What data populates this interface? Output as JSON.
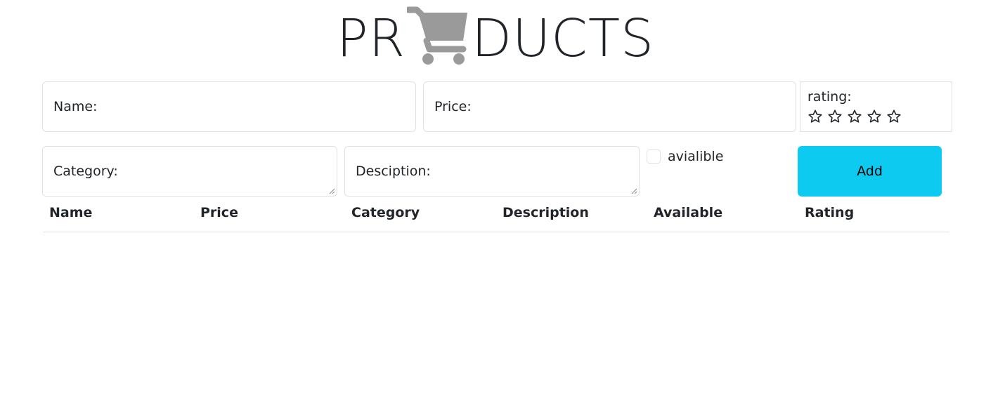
{
  "title": {
    "left": "PR",
    "right": "DUCTS",
    "icon": "shopping-cart-icon"
  },
  "form": {
    "name_label": "Name:",
    "price_label": "Price:",
    "rating_label": "rating:",
    "rating_value": 0,
    "rating_max": 5,
    "category_label": "Category:",
    "description_label": "Desciption:",
    "available_label": "avialible",
    "available_checked": false,
    "add_label": "Add"
  },
  "table": {
    "headers": [
      "Name",
      "Price",
      "Category",
      "Description",
      "Available",
      "Rating"
    ],
    "rows": []
  },
  "colors": {
    "accent": "#0dcaf0",
    "border": "#dee2e6",
    "icon": "#9a9a9a",
    "text": "#212529"
  }
}
